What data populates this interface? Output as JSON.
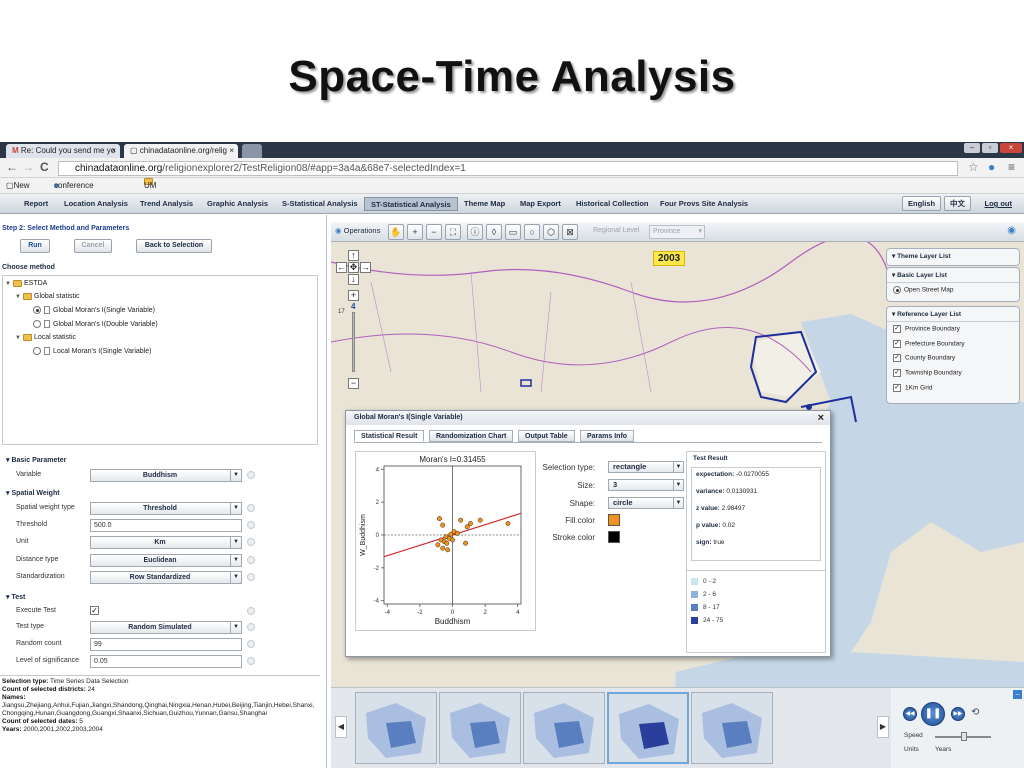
{
  "slide": {
    "title": "Space-Time Analysis"
  },
  "browser": {
    "tabs": [
      {
        "label": "Re: Could you send me yo"
      },
      {
        "label": "chinadataonline.org/relig"
      }
    ],
    "url_domain": "chinadataonline.org",
    "url_path": "/religionexplorer2/TestReligion08/#app=3a4a&68e7-selectedIndex=1",
    "bookmarks": [
      "New Tab",
      "conference of the as...",
      "UM"
    ]
  },
  "menu": {
    "items": [
      "Report",
      "Location Analysis",
      "Trend Analysis",
      "Graphic Analysis",
      "S-Statistical Analysis",
      "ST-Statistical Analysis",
      "Theme Map",
      "Map Export",
      "Historical Collection",
      "Four Provs Site Analysis"
    ],
    "active": "ST-Statistical Analysis",
    "english": "English",
    "chinese": "中文",
    "logout": "Log out"
  },
  "left": {
    "step_title": "Step 2: Select Method and Parameters",
    "run": "Run",
    "cancel": "Cancel",
    "back": "Back to Selection",
    "choose_method": "Choose method",
    "tree": {
      "root": "ESTDA",
      "global": "Global statistic",
      "global_single": "Global Moran's I(Single Variable)",
      "global_double": "Global Moran's I(Double Variable)",
      "local": "Local statistic",
      "local_single": "Local Moran's I(Single Variable)"
    },
    "basic": {
      "heading": "Basic Parameter",
      "variable_label": "Variable",
      "variable_value": "Buddhism"
    },
    "weight": {
      "heading": "Spatial Weight",
      "type_label": "Spatial weight type",
      "type_value": "Threshold",
      "threshold_label": "Threshold",
      "threshold_value": "500.0",
      "unit_label": "Unit",
      "unit_value": "Km",
      "distance_label": "Distance type",
      "distance_value": "Euclidean",
      "std_label": "Standardization",
      "std_value": "Row Standardized"
    },
    "test": {
      "heading": "Test",
      "execute_label": "Execute Test",
      "type_label": "Test type",
      "type_value": "Random Simulated",
      "count_label": "Random count",
      "count_value": "99",
      "sig_label": "Level of significance",
      "sig_value": "0.05"
    },
    "info": {
      "sel_type_k": "Selection type:",
      "sel_type_v": "Time Series Data Selection",
      "count_districts_k": "Count of selected districts:",
      "count_districts_v": "24",
      "names_k": "Names:",
      "names_v": "Jiangsu,Zhejiang,Anhui,Fujian,Jiangxi,Shandong,Qinghai,Ningxia,Henan,Hubei,Beijing,Tianjin,Hebei,Shanxi,Chongqing,Hunan,Guangdong,Guangxi,Shaanxi,Sichuan,Guizhou,Yunnan,Gansu,Shanghai",
      "count_dates_k": "Count of selected dates:",
      "count_dates_v": "5",
      "years_k": "Years:",
      "years_v": "2000,2001,2002,2003,2004"
    }
  },
  "map": {
    "operations": "Operations",
    "regional_level": "Regional",
    "level": "Level",
    "province": "Province",
    "year": "2003",
    "zoom_level": "4",
    "zoom_17": "17"
  },
  "layers": {
    "theme": "Theme Layer List",
    "basic": "Basic Layer List",
    "osm": "Open Street Map",
    "reference": "Reference Layer List",
    "items": [
      "Province Boundary",
      "Prefecture Boundary",
      "County Boundary",
      "Township Boundary",
      "1Km Grid"
    ]
  },
  "dialog": {
    "title": "Global Moran's I(Single Variable)",
    "tabs": [
      "Statistical Result",
      "Randomization Chart",
      "Output Table",
      "Params Info"
    ],
    "close": "×",
    "selection_type_label": "Selection type:",
    "selection_type_value": "rectangle",
    "size_label": "Size:",
    "size_value": "3",
    "shape_label": "Shape:",
    "shape_value": "circle",
    "fill_label": "Fill  color",
    "stroke_label": "Stroke color",
    "fill_color": "#f0921c",
    "stroke_color": "#000000",
    "test_result": {
      "heading": "Test Result",
      "expectation_k": "expectation:",
      "expectation_v": "-0.0270055",
      "variance_k": "variance:",
      "variance_v": "0.0130931",
      "z_k": "z value:",
      "z_v": "2.98497",
      "p_k": "p value:",
      "p_v": "0.02",
      "sign_k": "sign:",
      "sign_v": "true"
    },
    "legend": [
      {
        "label": "0 - 2",
        "color": "#c6e6f0"
      },
      {
        "label": "2 - 6",
        "color": "#8fb3d9"
      },
      {
        "label": "8 - 17",
        "color": "#5a7fc0"
      },
      {
        "label": "24 - 75",
        "color": "#2a3f9c"
      }
    ]
  },
  "player": {
    "speed": "Speed",
    "units": "Units",
    "years": "Years"
  },
  "chart_data": {
    "type": "scatter",
    "title": "Moran's I=0.31455",
    "xlabel": "Buddhism",
    "ylabel": "W_Buddhism",
    "xlim": [
      -4.2,
      4.2
    ],
    "ylim": [
      -4.2,
      4.2
    ],
    "xticks": [
      -4,
      -2,
      0,
      2,
      4
    ],
    "yticks": [
      -4,
      -2,
      0,
      2,
      4
    ],
    "points": [
      {
        "x": -0.9,
        "y": -0.6
      },
      {
        "x": -0.7,
        "y": -0.3
      },
      {
        "x": -0.6,
        "y": -0.8
      },
      {
        "x": -0.5,
        "y": -0.4
      },
      {
        "x": -0.4,
        "y": -0.1
      },
      {
        "x": -0.35,
        "y": -0.5
      },
      {
        "x": -0.3,
        "y": -0.9
      },
      {
        "x": -0.2,
        "y": -0.2
      },
      {
        "x": -0.1,
        "y": 0.05
      },
      {
        "x": 0.0,
        "y": -0.3
      },
      {
        "x": 0.1,
        "y": 0.2
      },
      {
        "x": 0.3,
        "y": 0.1
      },
      {
        "x": -0.6,
        "y": 0.6
      },
      {
        "x": -0.8,
        "y": 1.0
      },
      {
        "x": 0.5,
        "y": 0.9
      },
      {
        "x": 0.9,
        "y": 0.5
      },
      {
        "x": 1.1,
        "y": 0.7
      },
      {
        "x": 1.7,
        "y": 0.9
      },
      {
        "x": 0.8,
        "y": -0.5
      },
      {
        "x": 3.4,
        "y": 0.7
      }
    ],
    "regression": {
      "slope": 0.31455,
      "intercept": 0.0
    }
  }
}
